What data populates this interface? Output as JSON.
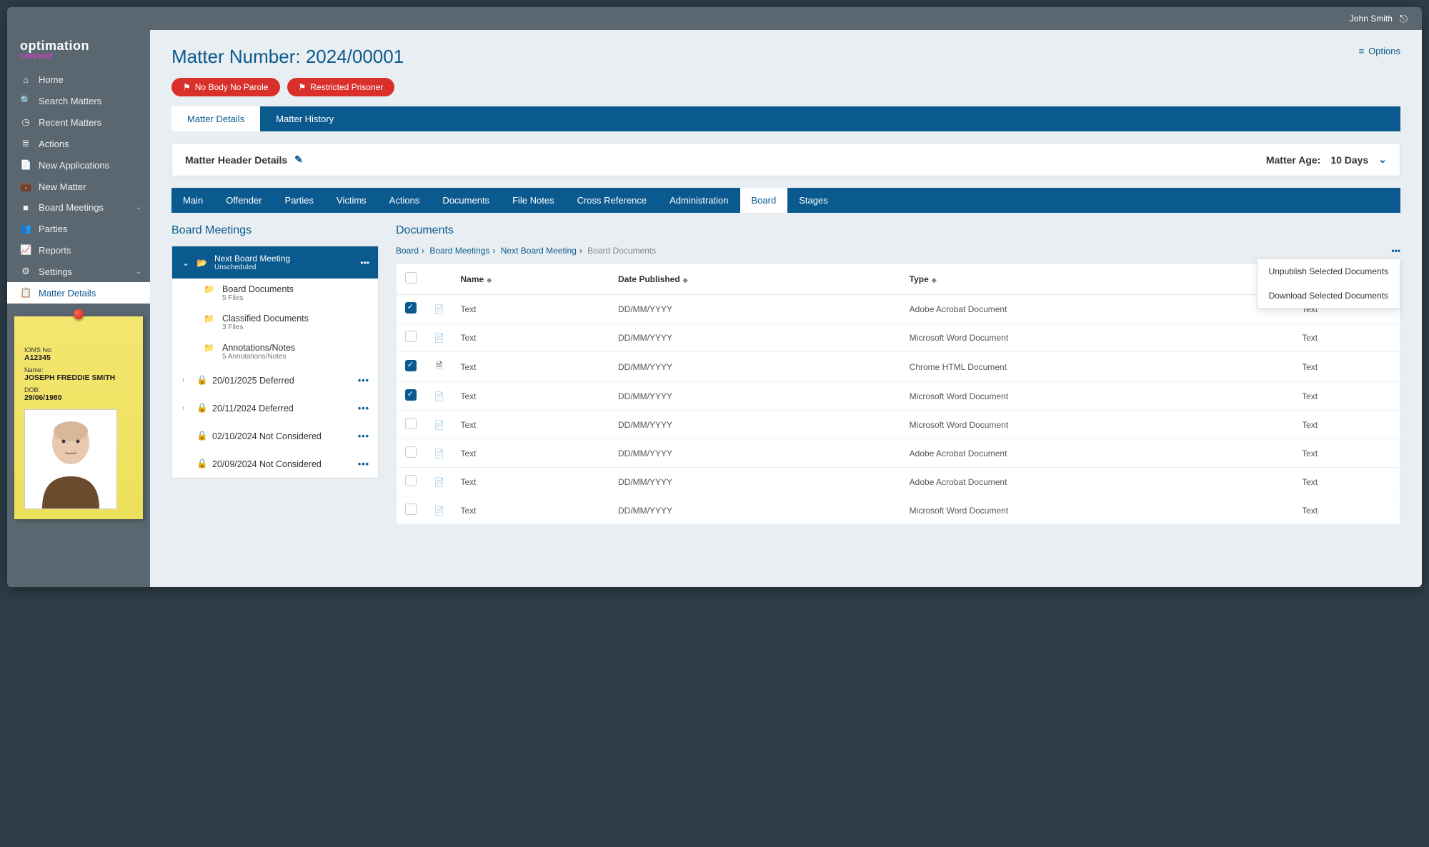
{
  "topbar": {
    "user": "John Smith"
  },
  "brand": {
    "line1": "optimation",
    "line2": "connect"
  },
  "sidebar": {
    "items": [
      {
        "label": "Home"
      },
      {
        "label": "Search Matters"
      },
      {
        "label": "Recent Matters"
      },
      {
        "label": "Actions"
      },
      {
        "label": "New Applications"
      },
      {
        "label": "New Matter"
      },
      {
        "label": "Board Meetings"
      },
      {
        "label": "Parties"
      },
      {
        "label": "Reports"
      },
      {
        "label": "Settings"
      },
      {
        "label": "Matter Details"
      }
    ]
  },
  "sticky": {
    "ioms_label": "IOMS No:",
    "ioms": "A12345",
    "name_label": "Name:",
    "name": "JOSEPH FREDDIE SMITH",
    "dob_label": "DOB:",
    "dob": "29/06/1980"
  },
  "page": {
    "title": "Matter Number: 2024/00001",
    "options": "Options",
    "badges": [
      "No Body No Parole",
      "Restricted Prisoner"
    ]
  },
  "tabs1": {
    "items": [
      "Matter Details",
      "Matter History"
    ],
    "active": 0
  },
  "headerPanel": {
    "title": "Matter Header Details",
    "age_label": "Matter Age:",
    "age_value": "10 Days"
  },
  "tabs2": {
    "items": [
      "Main",
      "Offender",
      "Parties",
      "Victims",
      "Actions",
      "Documents",
      "File Notes",
      "Cross Reference",
      "Administration",
      "Board",
      "Stages"
    ],
    "active": 9
  },
  "boardMeetings": {
    "section_title": "Board Meetings",
    "current": {
      "title": "Next Board Meeting",
      "sub": "Unscheduled"
    },
    "folders": [
      {
        "title": "Board Documents",
        "sub": "5 Files"
      },
      {
        "title": "Classified Documents",
        "sub": "3 Files"
      },
      {
        "title": "Annotations/Notes",
        "sub": "5 Annotations/Notes"
      }
    ],
    "past": [
      {
        "date": "20/01/2025",
        "status": "Deferred",
        "expandable": true
      },
      {
        "date": "20/11/2024",
        "status": "Deferred",
        "expandable": true
      },
      {
        "date": "02/10/2024",
        "status": "Not Considered",
        "expandable": false
      },
      {
        "date": "20/09/2024",
        "status": "Not Considered",
        "expandable": false
      }
    ]
  },
  "documents": {
    "section_title": "Documents",
    "breadcrumbs": [
      "Board",
      "Board Meetings",
      "Next Board Meeting",
      "Board Documents"
    ],
    "menu": [
      "Unpublish Selected Documents",
      "Download Selected Documents"
    ],
    "columns": {
      "name": "Name",
      "date": "Date Published",
      "type": "Type"
    },
    "rows": [
      {
        "checked": true,
        "icon": "pdf",
        "name": "Text",
        "date": "DD/MM/YYYY",
        "type": "Adobe Acrobat Document",
        "extra": "Text"
      },
      {
        "checked": false,
        "icon": "word",
        "name": "Text",
        "date": "DD/MM/YYYY",
        "type": "Microsoft Word Document",
        "extra": "Text"
      },
      {
        "checked": true,
        "icon": "file",
        "name": "Text",
        "date": "DD/MM/YYYY",
        "type": "Chrome HTML Document",
        "extra": "Text"
      },
      {
        "checked": true,
        "icon": "word",
        "name": "Text",
        "date": "DD/MM/YYYY",
        "type": "Microsoft Word Document",
        "extra": "Text"
      },
      {
        "checked": false,
        "icon": "word",
        "name": "Text",
        "date": "DD/MM/YYYY",
        "type": "Microsoft Word Document",
        "extra": "Text"
      },
      {
        "checked": false,
        "icon": "pdf",
        "name": "Text",
        "date": "DD/MM/YYYY",
        "type": "Adobe Acrobat Document",
        "extra": "Text"
      },
      {
        "checked": false,
        "icon": "pdf",
        "name": "Text",
        "date": "DD/MM/YYYY",
        "type": "Adobe Acrobat Document",
        "extra": "Text"
      },
      {
        "checked": false,
        "icon": "word",
        "name": "Text",
        "date": "DD/MM/YYYY",
        "type": "Microsoft Word Document",
        "extra": "Text"
      }
    ]
  }
}
